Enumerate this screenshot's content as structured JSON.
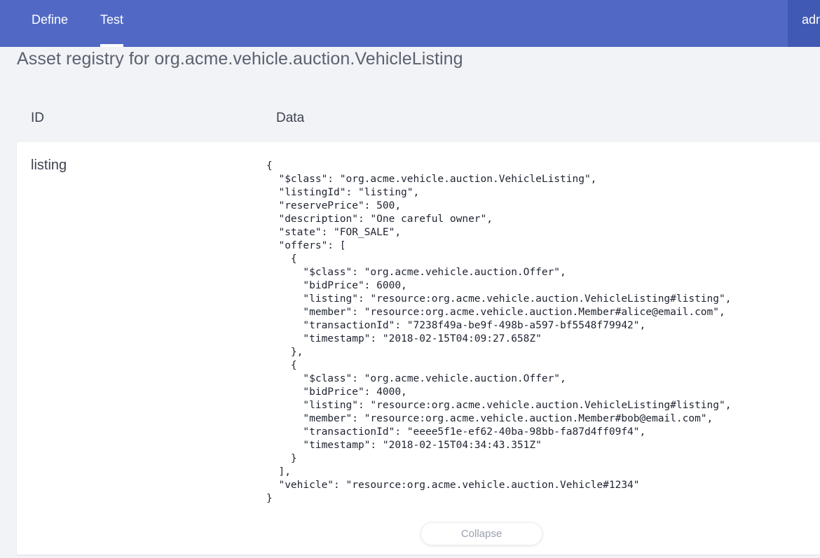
{
  "nav": {
    "tabs": [
      {
        "label": "Define",
        "active": false
      },
      {
        "label": "Test",
        "active": true
      }
    ],
    "user_label": "admin"
  },
  "page": {
    "title": "Asset registry for org.acme.vehicle.auction.VehicleListing"
  },
  "table": {
    "columns": [
      "ID",
      "Data"
    ],
    "rows": [
      {
        "id": "listing",
        "data": "{\n  \"$class\": \"org.acme.vehicle.auction.VehicleListing\",\n  \"listingId\": \"listing\",\n  \"reservePrice\": 500,\n  \"description\": \"One careful owner\",\n  \"state\": \"FOR_SALE\",\n  \"offers\": [\n    {\n      \"$class\": \"org.acme.vehicle.auction.Offer\",\n      \"bidPrice\": 6000,\n      \"listing\": \"resource:org.acme.vehicle.auction.VehicleListing#listing\",\n      \"member\": \"resource:org.acme.vehicle.auction.Member#alice@email.com\",\n      \"transactionId\": \"7238f49a-be9f-498b-a597-bf5548f79942\",\n      \"timestamp\": \"2018-02-15T04:09:27.658Z\"\n    },\n    {\n      \"$class\": \"org.acme.vehicle.auction.Offer\",\n      \"bidPrice\": 4000,\n      \"listing\": \"resource:org.acme.vehicle.auction.VehicleListing#listing\",\n      \"member\": \"resource:org.acme.vehicle.auction.Member#bob@email.com\",\n      \"transactionId\": \"eeee5f1e-ef62-40ba-98bb-fa87d4ff09f4\",\n      \"timestamp\": \"2018-02-15T04:34:43.351Z\"\n    }\n  ],\n  \"vehicle\": \"resource:org.acme.vehicle.auction.Vehicle#1234\"\n}",
        "collapse_label": "Collapse"
      }
    ]
  },
  "colors": {
    "topbar": "#5169c4",
    "user_area": "#4059b3",
    "page_bg": "#f2f3f6",
    "card_bg": "#ffffff"
  }
}
